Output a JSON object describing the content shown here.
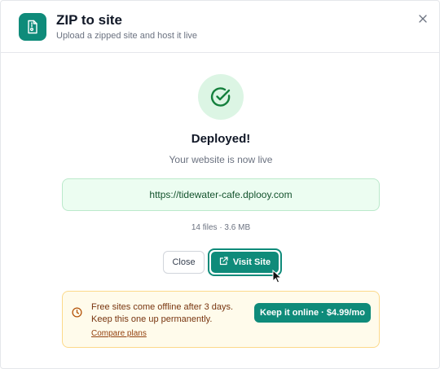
{
  "dialog": {
    "title": "ZIP to site",
    "subtitle": "Upload a zipped site and host it live",
    "icon": "zip-file-icon",
    "close_icon": "close-icon"
  },
  "status": {
    "icon": "check-circle-icon",
    "heading": "Deployed!",
    "message": "Your website is now live",
    "url": "https://tidewater-cafe.dplooy.com",
    "file_info": "14 files · 3.6 MB"
  },
  "actions": {
    "close_label": "Close",
    "visit_label": "Visit Site",
    "visit_icon": "external-link-icon"
  },
  "promo": {
    "icon": "clock-icon",
    "line1": "Free sites come offline after 3 days.",
    "line2": "Keep this one up permanently.",
    "link": "Compare plans",
    "button": "Keep it online · $4.99/mo"
  },
  "colors": {
    "accent": "#0f8b7a",
    "success_bg": "#dcf5e4",
    "url_bg": "#ecfdf1",
    "promo_bg": "#fffbeb",
    "promo_border": "#fcd98a"
  }
}
